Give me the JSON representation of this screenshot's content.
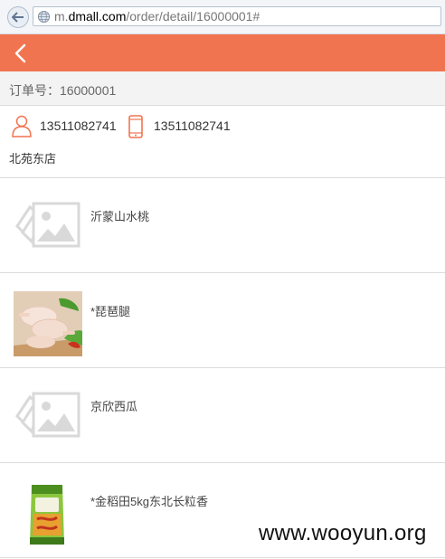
{
  "browser": {
    "url_prefix": "m.",
    "url_domain": "dmall.com",
    "url_path": "/order/detail/16000001#"
  },
  "header": {
    "back_icon": "chevron-left-icon",
    "background_color": "#f17450"
  },
  "order": {
    "label": "订单号：16000001"
  },
  "contact": {
    "phone": "13511082741",
    "mobile": "13511082741",
    "store": "北苑东店",
    "icon_color": "#f17450"
  },
  "items": [
    {
      "name": "沂蒙山水桃",
      "image": "image-placeholder-icon"
    },
    {
      "name": "*琵琶腿",
      "image": "chicken-drumstick-photo"
    },
    {
      "name": "京欣西瓜",
      "image": "image-placeholder-icon"
    },
    {
      "name": "*金稻田5kg东北长粒香",
      "image": "rice-bag-photo"
    }
  ],
  "watermark": "www.wooyun.org"
}
